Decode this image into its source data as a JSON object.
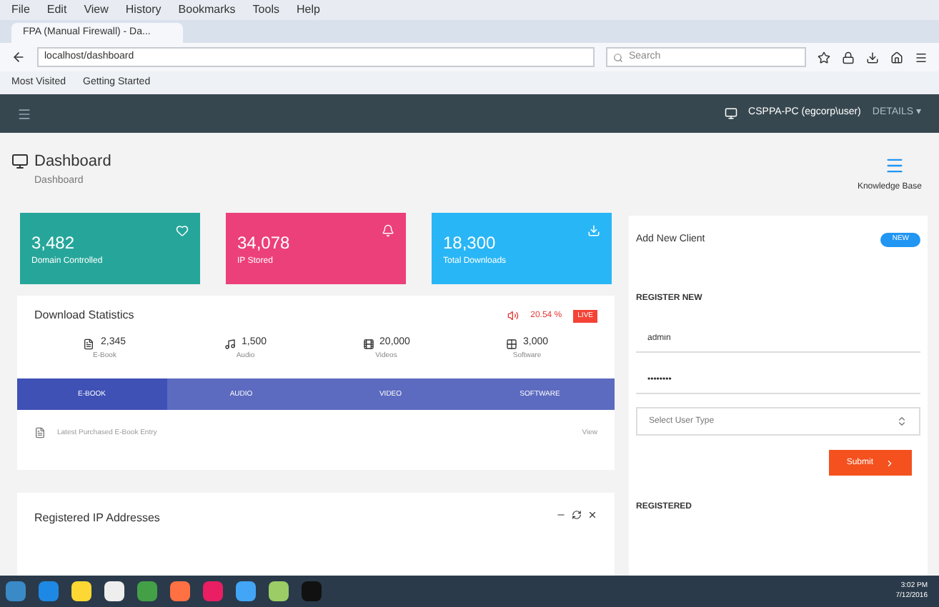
{
  "browser": {
    "menu": [
      "File",
      "Edit",
      "View",
      "History",
      "Bookmarks",
      "Tools",
      "Help"
    ],
    "tabs": [
      {
        "label": "FPA (Manual Firewall) - Da...",
        "selected": true
      }
    ],
    "url": "localhost/dashboard",
    "search": {
      "placeholder": "Search"
    },
    "bookmarks": [
      "Most Visited",
      "Getting Started"
    ]
  },
  "header": {
    "user": "CSPPA-PC (egcorp\\user)",
    "menu": "DETAILS ▾"
  },
  "page": {
    "title": "Dashboard",
    "breadcrumb": "Dashboard",
    "side_link": "Knowledge Base"
  },
  "stat_cards": [
    {
      "value": "3,482",
      "label": "Domain Controlled",
      "color": "#26a69a"
    },
    {
      "value": "34,078",
      "label": "IP Stored",
      "color": "#ec407a"
    },
    {
      "value": "18,300",
      "label": "Total Downloads",
      "color": "#29b6f6"
    }
  ],
  "statistics": {
    "title": "Download Statistics",
    "reading": "20.54 %",
    "badge": "LIVE",
    "items": [
      {
        "value": "2,345",
        "label": "E-Book"
      },
      {
        "value": "1,500",
        "label": "Audio"
      },
      {
        "value": "20,000",
        "label": "Videos"
      },
      {
        "value": "3,000",
        "label": "Software"
      }
    ],
    "tabs": [
      {
        "label": "E-BOOK",
        "selected": true
      },
      {
        "label": "AUDIO",
        "selected": false
      },
      {
        "label": "VIDEO",
        "selected": false
      },
      {
        "label": "SOFTWARE",
        "selected": false
      }
    ],
    "row": {
      "text": "Latest Purchased E-Book Entry",
      "action": "View"
    }
  },
  "ip_panel": {
    "title": "Registered IP Addresses"
  },
  "client": {
    "title": "Add New Client",
    "badge": "NEW",
    "section": "REGISTER NEW",
    "username": "admin",
    "password": "••••••••",
    "select": {
      "placeholder": "Select User Type"
    },
    "submit": "Submit",
    "section_2": "REGISTERED"
  },
  "taskbar": {
    "time": "3:02 PM",
    "date": "7/12/2016"
  }
}
